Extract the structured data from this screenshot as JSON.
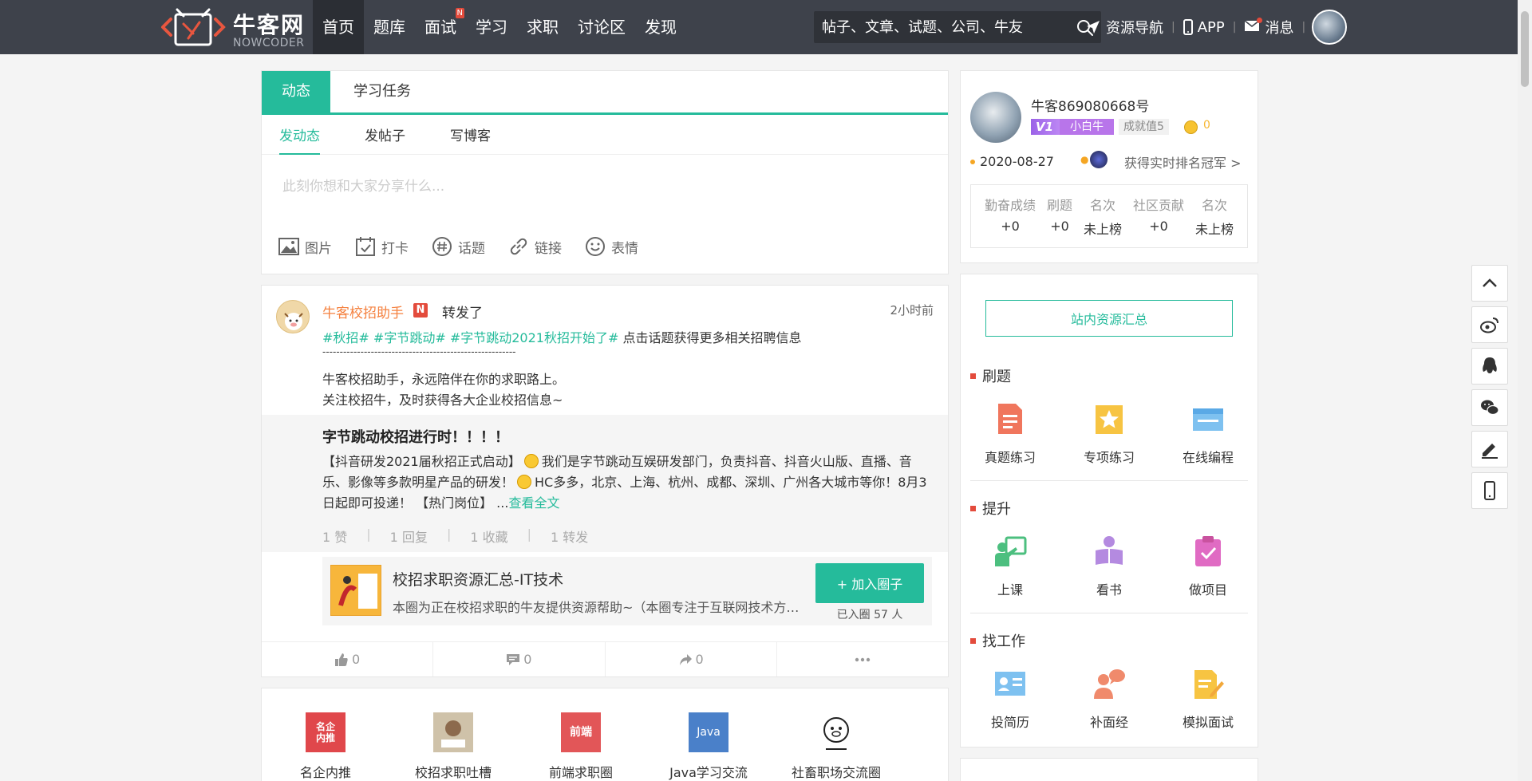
{
  "brand": {
    "name": "牛客网",
    "sub": "NOWCODER"
  },
  "nav": [
    {
      "label": "首页",
      "active": true
    },
    {
      "label": "题库"
    },
    {
      "label": "面试",
      "badge": "N"
    },
    {
      "label": "学习"
    },
    {
      "label": "求职"
    },
    {
      "label": "讨论区"
    },
    {
      "label": "发现"
    }
  ],
  "search": {
    "placeholder": "帖子、文章、试题、公司、牛友"
  },
  "topright": {
    "resources": "资源导航",
    "app": "APP",
    "messages": "消息"
  },
  "postbox": {
    "tab_active": "动态",
    "tab_other": "学习任务",
    "subtabs": [
      "发动态",
      "发帖子",
      "写博客"
    ],
    "placeholder": "此刻你想和大家分享什么...",
    "tools": [
      "图片",
      "打卡",
      "话题",
      "链接",
      "表情"
    ]
  },
  "feed": {
    "author": "牛客校招助手",
    "badge": "N",
    "action": "转发了",
    "time": "2小时前",
    "topics": [
      "#秋招#",
      "#字节跳动#",
      "#字节跳动2021秋招开始了#"
    ],
    "topic_tail": "点击话题获得更多相关招聘信息",
    "divider": "--------------------------------------------------------",
    "line1": "牛客校招助手，永远陪伴在你的求职路上。",
    "line2": "关注校招牛，及时获得各大企业校招信息~",
    "quote": {
      "title": "字节跳动校招进行时！！！！",
      "body_1": "【抖音研发2021届秋招正式启动】",
      "body_2": "我们是字节跳动互娱研发部门，负责抖音、抖音火山版、直播、音乐、影像等多款明星产品的研发！",
      "body_3": "HC多多，北京、上海、杭州、成都、深圳、广州各大城市等你！8月3日起即可投递！  【热门岗位】  ...",
      "more": "查看全文",
      "stats": [
        "1 赞",
        "1 回复",
        "1 收藏",
        "1 转发"
      ]
    },
    "circle": {
      "title": "校招求职资源汇总-IT技术",
      "desc": "本圈为正在校招求职的牛友提供资源帮助~（本圈专注于互联网技术方向）",
      "join": "+ 加入圈子",
      "count": "已入圈 57 人"
    },
    "actions": [
      "0",
      "0",
      "0"
    ]
  },
  "circles": [
    {
      "label": "名企内推",
      "icon": "名企\n内推",
      "color": "#e0474b"
    },
    {
      "label": "校招求职吐槽",
      "icon": "",
      "color": "#8c7a6b"
    },
    {
      "label": "前端求职圈",
      "icon": "前端",
      "color": "#e25658"
    },
    {
      "label": "Java学习交流",
      "icon": "Java",
      "color": "#4a80c9"
    },
    {
      "label": "社畜职场交流圈",
      "icon": "",
      "color": "#ffffff"
    }
  ],
  "user": {
    "name": "牛客869080668号",
    "v": "V1",
    "level": "小白牛",
    "score": "成就值5",
    "coins": "0",
    "date": "2020-08-27",
    "rank_link": "获得实时排名冠军 >",
    "stats": [
      {
        "label": "勤奋成绩",
        "value": "+0"
      },
      {
        "label": "刷题",
        "value": "+0"
      },
      {
        "label": "名次",
        "value": "未上榜"
      },
      {
        "label": "社区贡献",
        "value": "+0"
      },
      {
        "label": "名次",
        "value": "未上榜"
      }
    ]
  },
  "resources": {
    "button": "站内资源汇总",
    "sections": [
      {
        "title": "刷题",
        "items": [
          "真题练习",
          "专项练习",
          "在线编程"
        ]
      },
      {
        "title": "提升",
        "items": [
          "上课",
          "看书",
          "做项目"
        ]
      },
      {
        "title": "找工作",
        "items": [
          "投简历",
          "补面经",
          "模拟面试"
        ]
      }
    ]
  }
}
